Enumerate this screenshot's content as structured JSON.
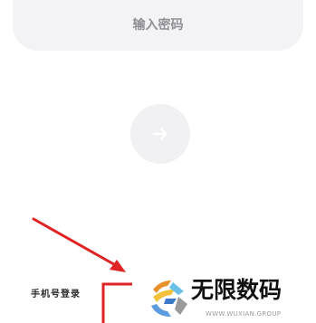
{
  "password": {
    "placeholder": "输入密码",
    "value": ""
  },
  "submit": {
    "icon": "arrow-right-icon"
  },
  "footer": {
    "phone_login_label": "手机号登录"
  },
  "annotation": {
    "arrow_color": "#e02424"
  },
  "watermark": {
    "title": "无限数码",
    "url": "WWW.WUXIAN.GROUP"
  }
}
